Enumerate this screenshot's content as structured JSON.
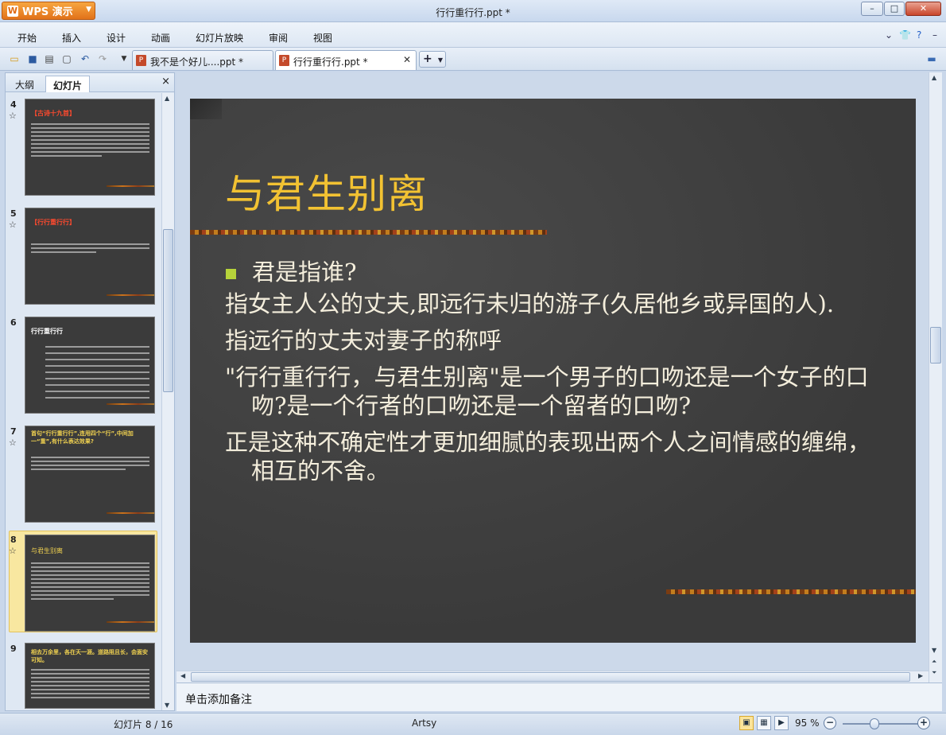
{
  "app": {
    "name": "WPS 演示",
    "title": "行行重行行.ppt *"
  },
  "window_controls": {
    "minimize": "–",
    "maximize": "□",
    "close": "✕"
  },
  "menu": [
    "开始",
    "插入",
    "设计",
    "动画",
    "幻灯片放映",
    "审阅",
    "视图"
  ],
  "toolbar_icons": [
    "folder-open-icon",
    "save-icon",
    "print-icon",
    "print-preview-icon",
    "undo-icon",
    "redo-icon"
  ],
  "tabs": [
    {
      "label": "我不是个好儿....ppt *",
      "active": false
    },
    {
      "label": "行行重行行.ppt *",
      "active": true
    }
  ],
  "left_panel": {
    "tabs": [
      "大纲",
      "幻灯片"
    ],
    "close": "×",
    "slides": [
      {
        "num": "4",
        "title": "【古诗十九首】"
      },
      {
        "num": "5",
        "title": "【行行重行行】"
      },
      {
        "num": "6",
        "title": "行行重行行"
      },
      {
        "num": "7",
        "title": "首句“行行重行行”,连用四个“行”,中间加一“重”,有什么表达效果?"
      },
      {
        "num": "8",
        "title": "与君生别离"
      },
      {
        "num": "9",
        "title": "相去万余里，各在天一涯。道路阻且长，会面安可知。"
      }
    ]
  },
  "slide": {
    "title": "与君生别离",
    "bullet": "君是指谁?",
    "paragraphs": [
      "指女主人公的丈夫,即远行未归的游子(久居他乡或异国的人).",
      "指远行的丈夫对妻子的称呼",
      "\"行行重行行，与君生别离\"是一个男子的口吻还是一个女子的口吻?是一个行者的口吻还是一个留者的口吻?",
      "正是这种不确定性才更加细腻的表现出两个人之间情感的缠绵，相互的不舍。"
    ],
    "colors": {
      "background": "#3d3d3d",
      "title": "#f2c232",
      "body": "#f4eedc",
      "bullet": "#b6d33a"
    }
  },
  "notes_placeholder": "单击添加备注",
  "status": {
    "slide_counter": "幻灯片 8 / 16",
    "theme": "Artsy",
    "zoom": "95 %"
  }
}
